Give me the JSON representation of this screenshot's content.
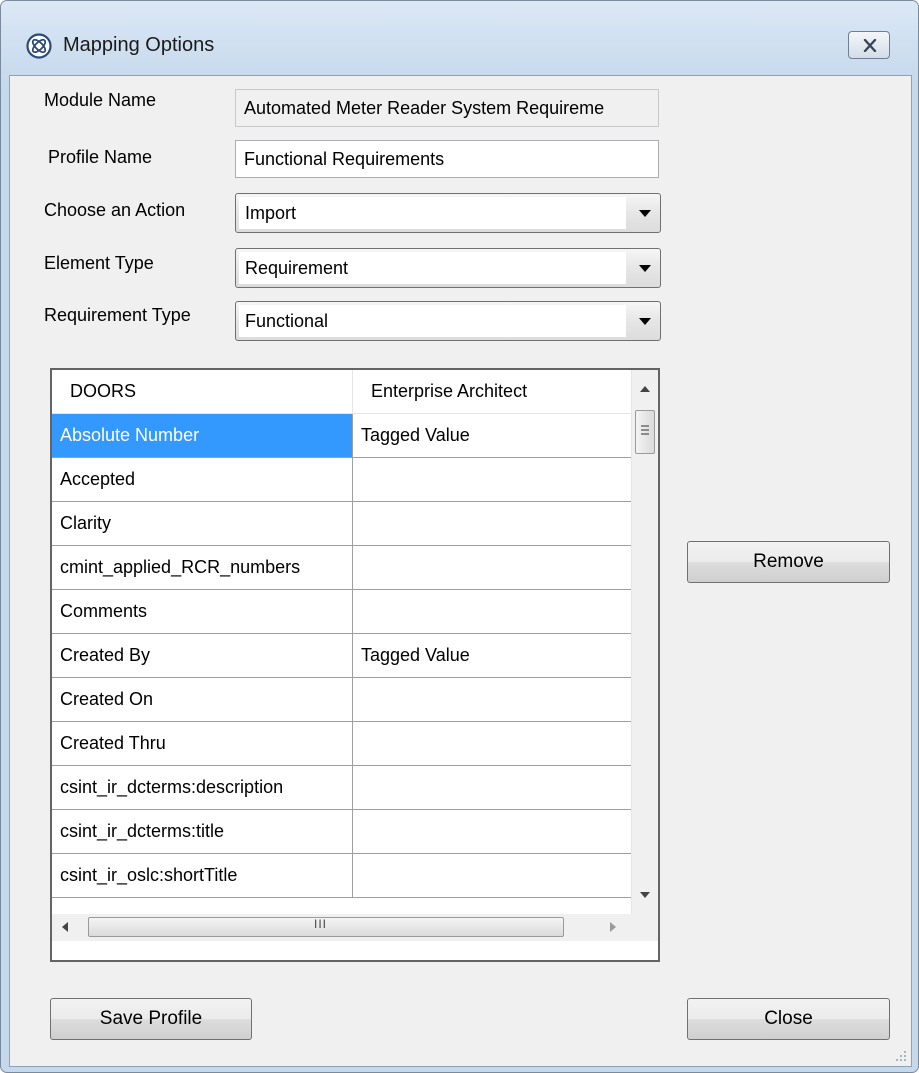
{
  "window": {
    "title": "Mapping Options",
    "icon": "ea-logo-icon",
    "close_icon": "close-icon"
  },
  "form": {
    "module_name_label": "Module Name",
    "module_name_value": "Automated Meter Reader System Requireme",
    "profile_name_label": "Profile Name",
    "profile_name_value": "Functional Requirements",
    "action_label": "Choose an Action",
    "action_value": "Import",
    "element_type_label": "Element Type",
    "element_type_value": "Requirement",
    "requirement_type_label": "Requirement Type",
    "requirement_type_value": "Functional"
  },
  "grid": {
    "columns": [
      "DOORS",
      "Enterprise Architect"
    ],
    "rows": [
      {
        "doors": "Absolute Number",
        "ea": "Tagged Value",
        "selected": true
      },
      {
        "doors": "Accepted",
        "ea": ""
      },
      {
        "doors": "Clarity",
        "ea": ""
      },
      {
        "doors": "cmint_applied_RCR_numbers",
        "ea": ""
      },
      {
        "doors": "Comments",
        "ea": ""
      },
      {
        "doors": "Created By",
        "ea": "Tagged Value"
      },
      {
        "doors": "Created On",
        "ea": ""
      },
      {
        "doors": "Created Thru",
        "ea": ""
      },
      {
        "doors": "csint_ir_dcterms:description",
        "ea": ""
      },
      {
        "doors": "csint_ir_dcterms:title",
        "ea": ""
      },
      {
        "doors": "csint_ir_oslc:shortTitle",
        "ea": ""
      }
    ],
    "hscroll_grip": "III"
  },
  "buttons": {
    "remove": "Remove",
    "save_profile": "Save Profile",
    "close": "Close"
  },
  "colors": {
    "selection": "#3399ff",
    "window_frame": "#c5d8ec",
    "dialog_bg": "#f0f0f0"
  }
}
